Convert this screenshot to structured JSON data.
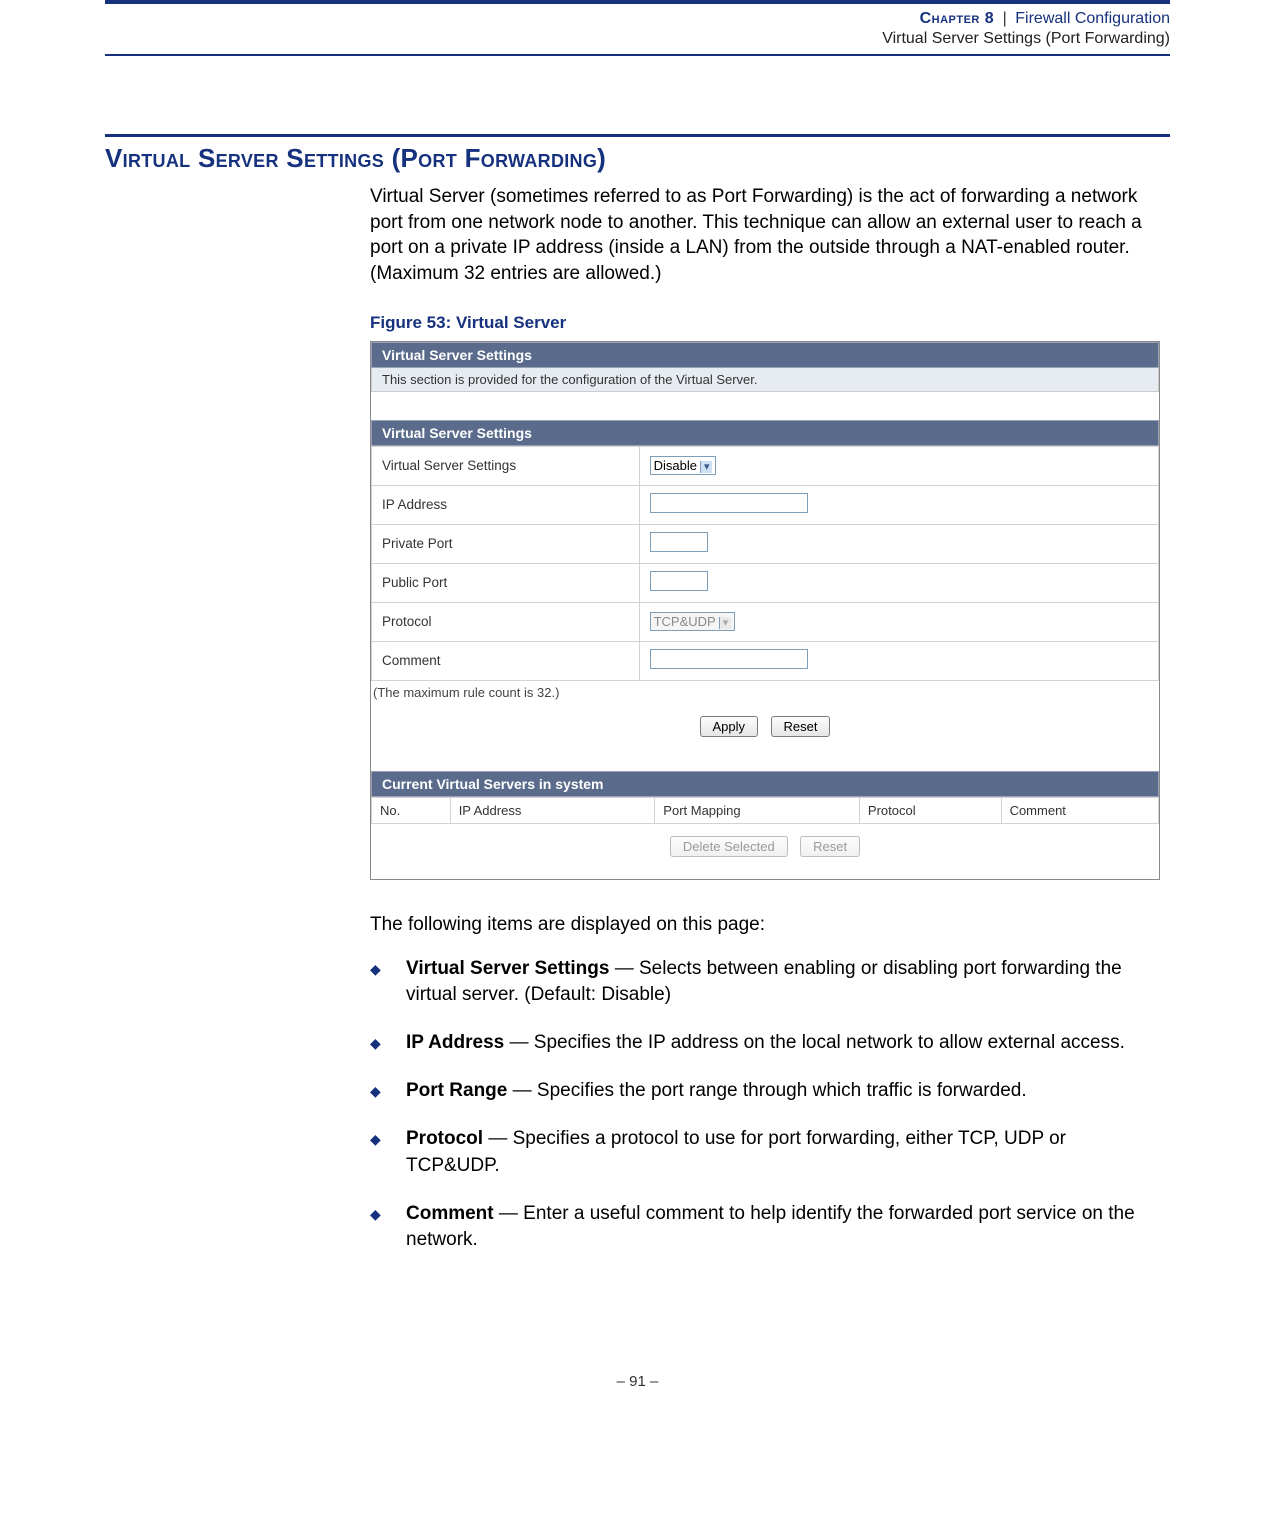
{
  "header": {
    "chapter_label": "Chapter 8",
    "separator": "|",
    "section_name": "Firewall Configuration",
    "subsection_name": "Virtual Server Settings (Port Forwarding)"
  },
  "section_title": "Virtual Server Settings (Port Forwarding)",
  "intro_paragraph": "Virtual Server (sometimes referred to as Port Forwarding) is the act of forwarding a network port from one network node to another. This technique can allow an external user to reach a port on a private IP address (inside a LAN) from the outside through a NAT-enabled router. (Maximum 32 entries are allowed.)",
  "figure_caption": "Figure 53:  Virtual Server",
  "figure": {
    "panel1_title": "Virtual Server Settings",
    "panel1_desc": "This section is provided for the configuration of the Virtual Server.",
    "panel2_title": "Virtual Server Settings",
    "rows": {
      "r0_label": "Virtual Server Settings",
      "r0_value": "Disable",
      "r1_label": "IP Address",
      "r2_label": "Private Port",
      "r3_label": "Public Port",
      "r4_label": "Protocol",
      "r4_value": "TCP&UDP",
      "r5_label": "Comment"
    },
    "note": "(The maximum rule count is 32.)",
    "btn_apply": "Apply",
    "btn_reset": "Reset",
    "panel3_title": "Current Virtual Servers in system",
    "list_headers": {
      "h0": "No.",
      "h1": "IP Address",
      "h2": "Port Mapping",
      "h3": "Protocol",
      "h4": "Comment"
    },
    "btn_delete": "Delete Selected",
    "btn_reset2": "Reset"
  },
  "items_intro": "The following items are displayed on this page:",
  "bullets": {
    "b0_term": "Virtual Server Settings",
    "b0_desc": " — Selects between enabling or disabling port forwarding the virtual server. (Default: Disable)",
    "b1_term": "IP Address",
    "b1_desc": " — Specifies the IP address on the local network to allow external access.",
    "b2_term": "Port Range",
    "b2_desc": " — Specifies the port range through which traffic is forwarded.",
    "b3_term": "Protocol",
    "b3_desc": " — Specifies a protocol to use for port forwarding, either TCP, UDP or TCP&UDP.",
    "b4_term": "Comment",
    "b4_desc": " — Enter a useful comment to help identify the forwarded port service on the network."
  },
  "footer": "–  91  –"
}
